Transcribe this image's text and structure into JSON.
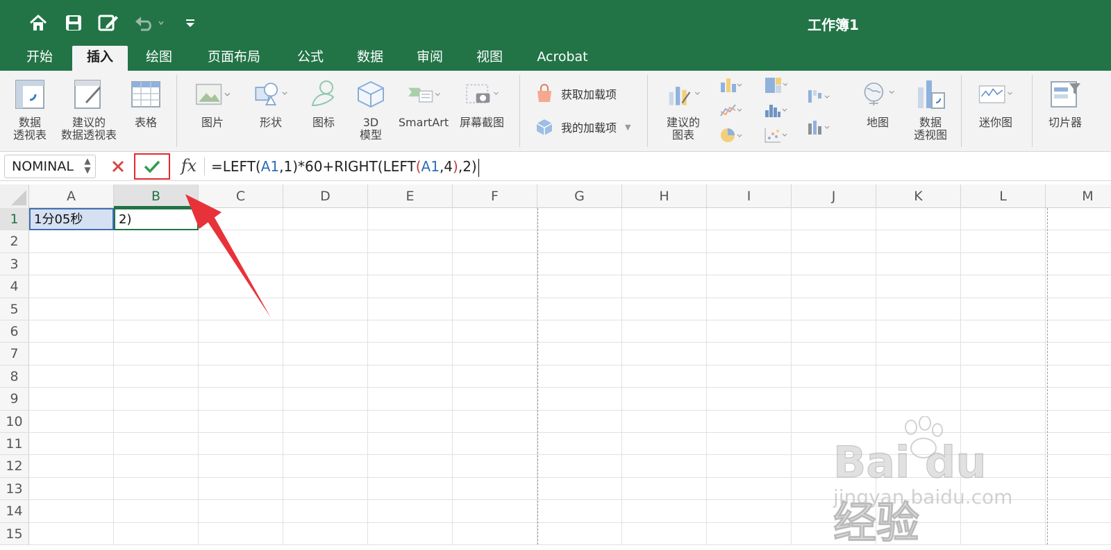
{
  "window": {
    "title": "工作簿1"
  },
  "quick_access": {
    "icons": [
      "home-icon",
      "save-icon",
      "edit-document-icon",
      "undo-icon",
      "customize-icon"
    ]
  },
  "tabs": [
    {
      "label": "开始",
      "active": false
    },
    {
      "label": "插入",
      "active": true
    },
    {
      "label": "绘图",
      "active": false
    },
    {
      "label": "页面布局",
      "active": false
    },
    {
      "label": "公式",
      "active": false
    },
    {
      "label": "数据",
      "active": false
    },
    {
      "label": "审阅",
      "active": false
    },
    {
      "label": "视图",
      "active": false
    },
    {
      "label": "Acrobat",
      "active": false
    }
  ],
  "ribbon": {
    "pivot_table": {
      "line1": "数据",
      "line2": "透视表"
    },
    "recommended_pivot": {
      "line1": "建议的",
      "line2": "数据透视表"
    },
    "table": {
      "label": "表格"
    },
    "pictures": {
      "label": "图片"
    },
    "shapes": {
      "label": "形状"
    },
    "icons": {
      "label": "图标"
    },
    "models3d": {
      "line1": "3D",
      "line2": "模型"
    },
    "smartart": {
      "label": "SmartArt"
    },
    "screenshot": {
      "label": "屏幕截图"
    },
    "get_addins": {
      "label": "获取加载项"
    },
    "my_addins": {
      "label": "我的加载项"
    },
    "recommended_charts": {
      "line1": "建议的",
      "line2": "图表"
    },
    "maps": {
      "label": "地图"
    },
    "pivot_chart": {
      "line1": "数据",
      "line2": "透视图"
    },
    "sparklines": {
      "label": "迷你图"
    },
    "slicer": {
      "label": "切片器"
    }
  },
  "formula_bar": {
    "name_box": "NOMINAL",
    "fx_label": "fx",
    "formula_parts": {
      "p1": "=LEFT(",
      "p2": "A1",
      "p3": ",1)*60+RIGHT(LEFT",
      "p4": "(",
      "p5": "A1",
      "p6": ",4",
      "p7": ")",
      "p8": ",2)"
    }
  },
  "sheet": {
    "columns": [
      "A",
      "B",
      "C",
      "D",
      "E",
      "F",
      "G",
      "H",
      "I",
      "J",
      "K",
      "L",
      "M"
    ],
    "rows": [
      "1",
      "2",
      "3",
      "4",
      "5",
      "6",
      "7",
      "8",
      "9",
      "10",
      "11",
      "12",
      "13",
      "14",
      "15"
    ],
    "selected_column": "B",
    "selected_row": "1",
    "cells": {
      "A1": "1分05秒",
      "B1": "2)"
    }
  },
  "watermark": {
    "brand": "Bai du 经验",
    "url": "jingyan.baidu.com"
  },
  "colors": {
    "accent": "#217346",
    "titlebar": "#227447",
    "highlight": "#e02b2b"
  }
}
